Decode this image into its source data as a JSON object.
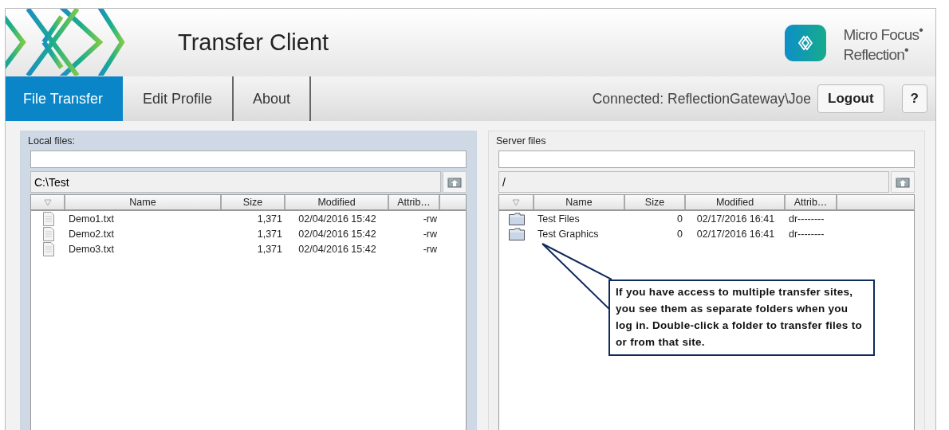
{
  "header": {
    "title": "Transfer Client",
    "brand_lines": [
      "Micro Focus$^{•}$",
      "Reflection$^{•}$"
    ]
  },
  "tabs": [
    {
      "label": "File Transfer",
      "selected": true
    },
    {
      "label": "Edit Profile",
      "selected": false
    },
    {
      "label": "About",
      "selected": false
    }
  ],
  "connection": {
    "status": "Connected: ReflectionGateway\\Joe",
    "logout": "Logout",
    "help": "?"
  },
  "panels": [
    {
      "label": "Local files:",
      "path": "C:\\Test",
      "columns": [
        "Name",
        "Size",
        "Modified",
        "Attrib…"
      ],
      "rows": [
        {
          "kind": "file",
          "name": "Demo1.txt",
          "size": "1,371",
          "modified": "02/04/2016 15:42",
          "attrib": "-rw"
        },
        {
          "kind": "file",
          "name": "Demo2.txt",
          "size": "1,371",
          "modified": "02/04/2016 15:42",
          "attrib": "-rw"
        },
        {
          "kind": "file",
          "name": "Demo3.txt",
          "size": "1,371",
          "modified": "02/04/2016 15:42",
          "attrib": "-rw"
        }
      ]
    },
    {
      "label": "Server files",
      "path": "/",
      "columns": [
        "Name",
        "Size",
        "Modified",
        "Attrib…"
      ],
      "rows": [
        {
          "kind": "folder",
          "name": "Test Files",
          "size": "0",
          "modified": "02/17/2016 16:41",
          "attrib": "dr--------"
        },
        {
          "kind": "folder",
          "name": "Test Graphics",
          "size": "0",
          "modified": "02/17/2016 16:41",
          "attrib": "dr--------"
        }
      ]
    }
  ],
  "callout": {
    "text": "If you have access to multiple transfer sites, you see them as separate folders when you log in. Double-click a folder to transfer files to or from that site."
  }
}
